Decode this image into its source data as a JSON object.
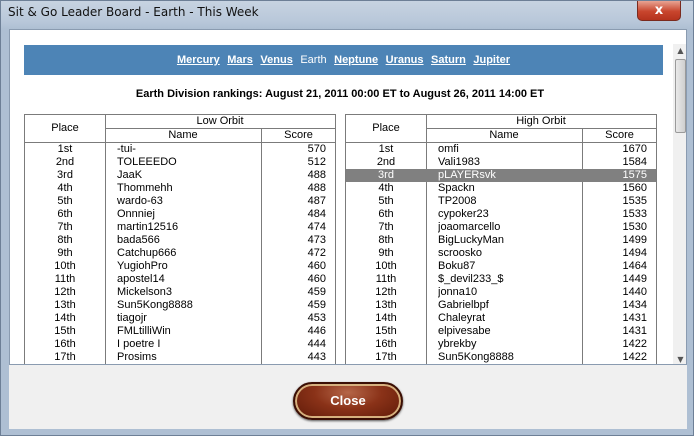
{
  "window": {
    "title": "Sit & Go Leader Board - Earth - This Week",
    "close_glyph": "x"
  },
  "planets": [
    {
      "label": "Mercury",
      "current": false
    },
    {
      "label": "Mars",
      "current": false
    },
    {
      "label": "Venus",
      "current": false
    },
    {
      "label": "Earth",
      "current": true
    },
    {
      "label": "Neptune",
      "current": false
    },
    {
      "label": "Uranus",
      "current": false
    },
    {
      "label": "Saturn",
      "current": false
    },
    {
      "label": "Jupiter",
      "current": false
    }
  ],
  "heading": "Earth Division rankings: August 21, 2011 00:00 ET to August 26, 2011 14:00 ET",
  "low_orbit": {
    "group_label": "Low Orbit",
    "place_header": "Place",
    "name_header": "Name",
    "score_header": "Score",
    "rows": [
      {
        "place": "1st",
        "name": "-tui-",
        "score": "570"
      },
      {
        "place": "2nd",
        "name": "TOLEEEDO",
        "score": "512"
      },
      {
        "place": "3rd",
        "name": "JaaK",
        "score": "488"
      },
      {
        "place": "4th",
        "name": "Thommehh",
        "score": "488"
      },
      {
        "place": "5th",
        "name": "wardo-63",
        "score": "487"
      },
      {
        "place": "6th",
        "name": "Onnniej",
        "score": "484"
      },
      {
        "place": "7th",
        "name": "martin12516",
        "score": "474"
      },
      {
        "place": "8th",
        "name": "bada566",
        "score": "473"
      },
      {
        "place": "9th",
        "name": "Catchup666",
        "score": "472"
      },
      {
        "place": "10th",
        "name": "YugiohPro",
        "score": "460"
      },
      {
        "place": "11th",
        "name": "apostel14",
        "score": "460"
      },
      {
        "place": "12th",
        "name": "Mickelson3",
        "score": "459"
      },
      {
        "place": "13th",
        "name": "Sun5Kong8888",
        "score": "459"
      },
      {
        "place": "14th",
        "name": "tiagojr",
        "score": "453"
      },
      {
        "place": "15th",
        "name": "FMLtilliWin",
        "score": "446"
      },
      {
        "place": "16th",
        "name": "I poetre I",
        "score": "444"
      },
      {
        "place": "17th",
        "name": "Prosims",
        "score": "443"
      }
    ]
  },
  "high_orbit": {
    "group_label": "High Orbit",
    "place_header": "Place",
    "name_header": "Name",
    "score_header": "Score",
    "rows": [
      {
        "place": "1st",
        "name": "omfi",
        "score": "1670"
      },
      {
        "place": "2nd",
        "name": "Vali1983",
        "score": "1584"
      },
      {
        "place": "3rd",
        "name": "pLAYERsvk",
        "score": "1575",
        "highlighted": true
      },
      {
        "place": "4th",
        "name": "Spackn",
        "score": "1560"
      },
      {
        "place": "5th",
        "name": "TP2008",
        "score": "1535"
      },
      {
        "place": "6th",
        "name": "cypoker23",
        "score": "1533"
      },
      {
        "place": "7th",
        "name": "joaomarcello",
        "score": "1530"
      },
      {
        "place": "8th",
        "name": "BigLuckyMan",
        "score": "1499"
      },
      {
        "place": "9th",
        "name": "scroosko",
        "score": "1494"
      },
      {
        "place": "10th",
        "name": "Boku87",
        "score": "1464"
      },
      {
        "place": "11th",
        "name": "$_devil233_$",
        "score": "1449"
      },
      {
        "place": "12th",
        "name": "jonna10",
        "score": "1440"
      },
      {
        "place": "13th",
        "name": "Gabrielbpf",
        "score": "1434"
      },
      {
        "place": "14th",
        "name": "Chaleyrat",
        "score": "1431"
      },
      {
        "place": "15th",
        "name": "elpivesabe",
        "score": "1431"
      },
      {
        "place": "16th",
        "name": "ybrekby",
        "score": "1422"
      },
      {
        "place": "17th",
        "name": "Sun5Kong8888",
        "score": "1422"
      }
    ]
  },
  "footer": {
    "close_label": "Close"
  },
  "icons": {
    "scroll_up": "up-arrow-icon",
    "scroll_down": "down-arrow-icon"
  },
  "colors": {
    "planet_bar": "#4d84b6",
    "highlight_row": "#808080",
    "close_button": "#8a3218"
  }
}
